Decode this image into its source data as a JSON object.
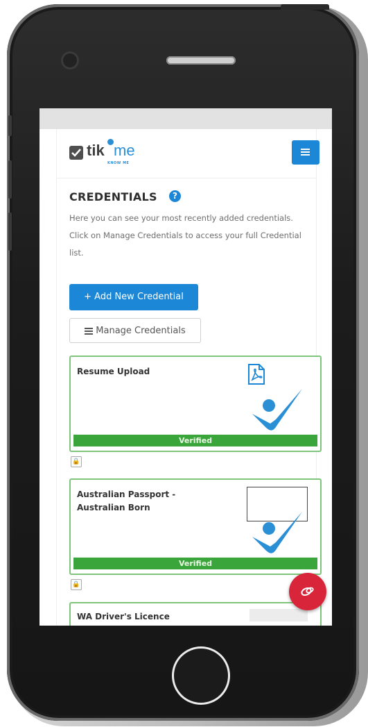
{
  "app": {
    "logo_text_a": "tik",
    "logo_text_b": "me",
    "logo_sub": "KNOW ME"
  },
  "page": {
    "title": "CREDENTIALS",
    "help_icon_glyph": "?",
    "intro": "Here you can see your most recently added credentials. Click on Manage Credentials to access your full Credential list."
  },
  "buttons": {
    "add_new": "+ Add New Credential",
    "manage": "Manage Credentials"
  },
  "credentials": [
    {
      "title": "Resume Upload",
      "status": "Verified",
      "thumbnail": "pdf-icon"
    },
    {
      "title": "Australian Passport - Australian Born",
      "status": "Verified",
      "thumbnail": "image-box"
    },
    {
      "title": "WA Driver's Licence"
    }
  ],
  "icons": {
    "menu": "hamburger-icon",
    "help": "question-circle-icon",
    "lock": "lock-icon",
    "fab": "chat-icon",
    "verified": "checkmark-person-icon"
  },
  "colors": {
    "primary": "#1b87d6",
    "verified": "#3aa53a",
    "card_border": "#7ec47a",
    "fab": "#d8253a"
  }
}
